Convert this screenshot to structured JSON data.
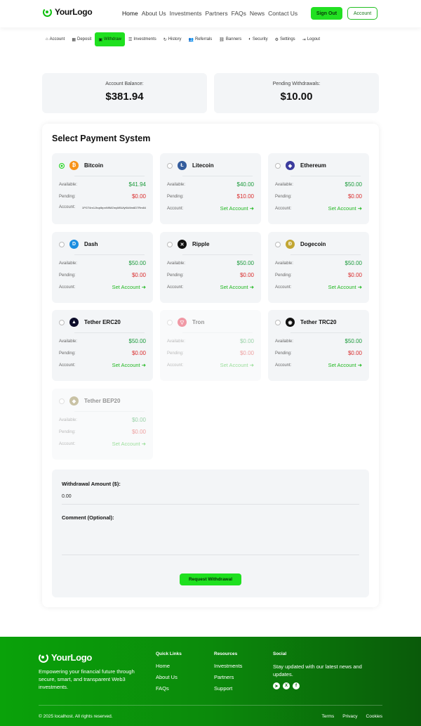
{
  "header": {
    "logo_text": "YourLogo",
    "nav": [
      "Home",
      "About Us",
      "Investments",
      "Partners",
      "FAQs",
      "News",
      "Contact Us"
    ],
    "sign_out": "Sign Out",
    "account": "Account"
  },
  "subnav": {
    "tabs": [
      {
        "icon": "⌂",
        "label": "Account"
      },
      {
        "icon": "▦",
        "label": "Deposit"
      },
      {
        "icon": "▣",
        "label": "Withdraw"
      },
      {
        "icon": "☰",
        "label": "Investments"
      },
      {
        "icon": "↻",
        "label": "History"
      },
      {
        "icon": "👥",
        "label": "Referrals"
      },
      {
        "icon": "⛓",
        "label": "Banners"
      },
      {
        "icon": "◐",
        "label": "Security"
      },
      {
        "icon": "⚙",
        "label": "Settings"
      },
      {
        "icon": "⇥",
        "label": "Logout"
      }
    ]
  },
  "balances": {
    "account_label": "Account Balance:",
    "account_value": "$381.94",
    "pending_label": "Pending Withdrawals:",
    "pending_value": "$10.00"
  },
  "payment": {
    "title": "Select Payment System",
    "labels": {
      "available": "Available:",
      "pending": "Pending:",
      "account": "Account:",
      "set_account": "Set Account ➜"
    },
    "systems": [
      {
        "name": "Bitcoin",
        "symbol": "₿",
        "color": "#f7931a",
        "available": "$41.94",
        "pending": "$0.00",
        "account": "1PGT4m1Jhqr8rpnN9MZmyM5UfyKkMm6D7Rm84",
        "selected": true,
        "disabled": false
      },
      {
        "name": "Litecoin",
        "symbol": "Ł",
        "color": "#345d9d",
        "available": "$40.00",
        "pending": "$10.00",
        "account": "",
        "selected": false,
        "disabled": false
      },
      {
        "name": "Ethereum",
        "symbol": "◆",
        "color": "#3c3c9e",
        "available": "$50.00",
        "pending": "$0.00",
        "account": "",
        "selected": false,
        "disabled": false
      },
      {
        "name": "Dash",
        "symbol": "D",
        "color": "#1c8ee0",
        "available": "$50.00",
        "pending": "$0.00",
        "account": "",
        "selected": false,
        "disabled": false
      },
      {
        "name": "Ripple",
        "symbol": "✕",
        "color": "#111111",
        "available": "$50.00",
        "pending": "$0.00",
        "account": "",
        "selected": false,
        "disabled": false
      },
      {
        "name": "Dogecoin",
        "symbol": "Ð",
        "color": "#c2a633",
        "available": "$50.00",
        "pending": "$0.00",
        "account": "",
        "selected": false,
        "disabled": false
      },
      {
        "name": "Tether ERC20",
        "symbol": "▲",
        "color": "#0d0d2a",
        "available": "$50.00",
        "pending": "$0.00",
        "account": "",
        "selected": false,
        "disabled": false
      },
      {
        "name": "Tron",
        "symbol": "▽",
        "color": "#e0203a",
        "available": "$0.00",
        "pending": "$0.00",
        "account": "",
        "selected": false,
        "disabled": true
      },
      {
        "name": "Tether TRC20",
        "symbol": "◉",
        "color": "#111111",
        "available": "$50.00",
        "pending": "$0.00",
        "account": "",
        "selected": false,
        "disabled": false
      },
      {
        "name": "Tether BEP20",
        "symbol": "◆",
        "color": "#8a7a3a",
        "available": "$0.00",
        "pending": "$0.00",
        "account": "",
        "selected": false,
        "disabled": true
      }
    ]
  },
  "form": {
    "amount_label": "Withdrawal Amount ($):",
    "amount_value": "0.00",
    "comment_label": "Comment (Optional):",
    "submit": "Request Withdrawal"
  },
  "footer": {
    "logo_text": "YourLogo",
    "description": "Empowering your financial future through secure, smart, and transparent Web3 investments.",
    "quick_title": "Quick Links",
    "quick_links": [
      "Home",
      "About Us",
      "FAQs"
    ],
    "resources_title": "Resources",
    "resources": [
      "Investments",
      "Partners",
      "Support"
    ],
    "social_title": "Social",
    "social_text": "Stay updated with our latest news and updates.",
    "copyright": "© 2025 localhost. All rights reserved.",
    "legal": [
      "Terms",
      "Privacy",
      "Cookies"
    ]
  }
}
